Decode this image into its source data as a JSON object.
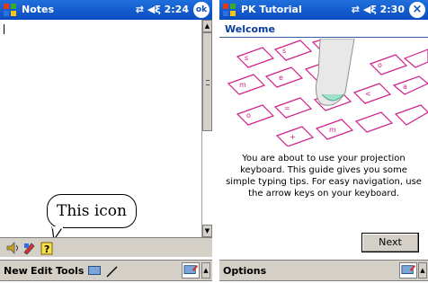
{
  "left_screen": {
    "title_bar": {
      "app_title": "Notes",
      "time": "2:24",
      "ok_label": "ok"
    },
    "callout_label": "This icon",
    "menu": [
      "New",
      "Edit",
      "Tools"
    ]
  },
  "right_screen": {
    "title_bar": {
      "app_title": "PK Tutorial",
      "time": "2:30",
      "close_glyph": "×"
    },
    "heading": "Welcome",
    "body_lines": [
      "You are about to use your projection",
      "keyboard. This guide gives you some",
      "simple typing tips. For easy navigation, use",
      "the arrow keys on your keyboard."
    ],
    "next_label": "Next",
    "menu": [
      "Options"
    ]
  },
  "icons": {
    "start": "windows-flag-icon",
    "connectivity": "connectivity-icon",
    "volume": "speaker-icon",
    "ok": "ok-icon",
    "close": "close-icon"
  },
  "colors": {
    "title_bar": "#0a4cc0",
    "chrome": "#d4d0c8",
    "welcome_text": "#0a3c9c",
    "keyboard_pattern": "#d0208a"
  }
}
